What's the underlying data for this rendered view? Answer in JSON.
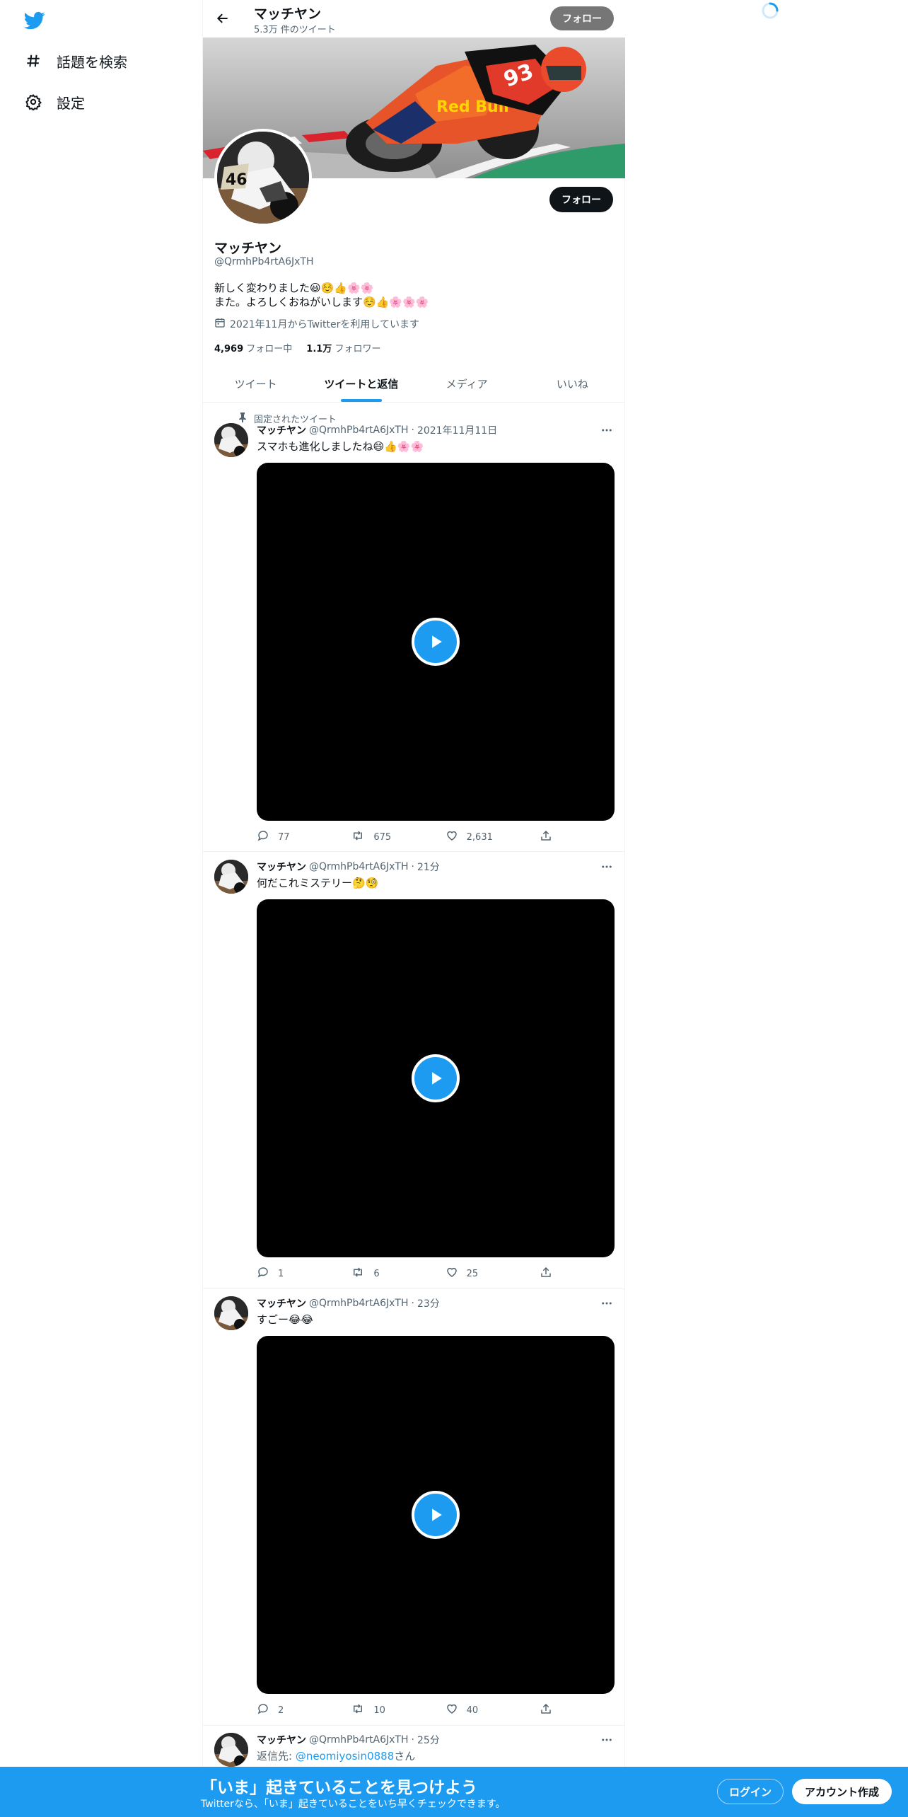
{
  "sidebar": {
    "items": [
      {
        "icon": "hashtag-icon",
        "label": "話題を検索"
      },
      {
        "icon": "gear-icon",
        "label": "設定"
      }
    ]
  },
  "header": {
    "name": "マッチヤン",
    "tweet_count": "5.3万 件のツイート",
    "follow_label": "フォロー"
  },
  "profile": {
    "name": "マッチヤン",
    "handle": "@QrmhPb4rtA6JxTH",
    "bio_line1": "新しく変わりました😃☺️👍🌸🌸",
    "bio_line2": "また。よろしくおねがいします☺️👍🌸🌸🌸",
    "joined": "2021年11月からTwitterを利用しています",
    "following_count": "4,969",
    "following_label": "フォロー中",
    "followers_count": "1.1万",
    "followers_label": "フォロワー",
    "follow_label": "フォロー"
  },
  "tabs": [
    {
      "label": "ツイート",
      "active": false
    },
    {
      "label": "ツイートと返信",
      "active": true
    },
    {
      "label": "メディア",
      "active": false
    },
    {
      "label": "いいね",
      "active": false
    }
  ],
  "tweets": [
    {
      "pinned_label": "固定されたツイート",
      "name": "マッチヤン",
      "handle": "@QrmhPb4rtA6JxTH",
      "time": "2021年11月11日",
      "text": "スマホも進化しましたね😄👍🌸🌸",
      "replies": "77",
      "retweets": "675",
      "likes": "2,631"
    },
    {
      "name": "マッチヤン",
      "handle": "@QrmhPb4rtA6JxTH",
      "time": "21分",
      "text": "何だこれミステリー🤔🧐",
      "replies": "1",
      "retweets": "6",
      "likes": "25"
    },
    {
      "name": "マッチヤン",
      "handle": "@QrmhPb4rtA6JxTH",
      "time": "23分",
      "text": "すごー😂😂",
      "replies": "2",
      "retweets": "10",
      "likes": "40"
    },
    {
      "name": "マッチヤン",
      "handle": "@QrmhPb4rtA6JxTH",
      "time": "25分",
      "reply_prefix": "返信先: ",
      "reply_to": "@neomiyosin0888",
      "reply_suffix": "さん"
    }
  ],
  "bottom_bar": {
    "title": "「いま」起きていることを見つけよう",
    "subtitle": "Twitterなら、「いま」起きていることをいち早くチェックできます。",
    "login_label": "ログイン",
    "signup_label": "アカウント作成"
  },
  "colors": {
    "accent": "#1d9bf0",
    "text": "#0f1419",
    "secondary": "#536471"
  }
}
